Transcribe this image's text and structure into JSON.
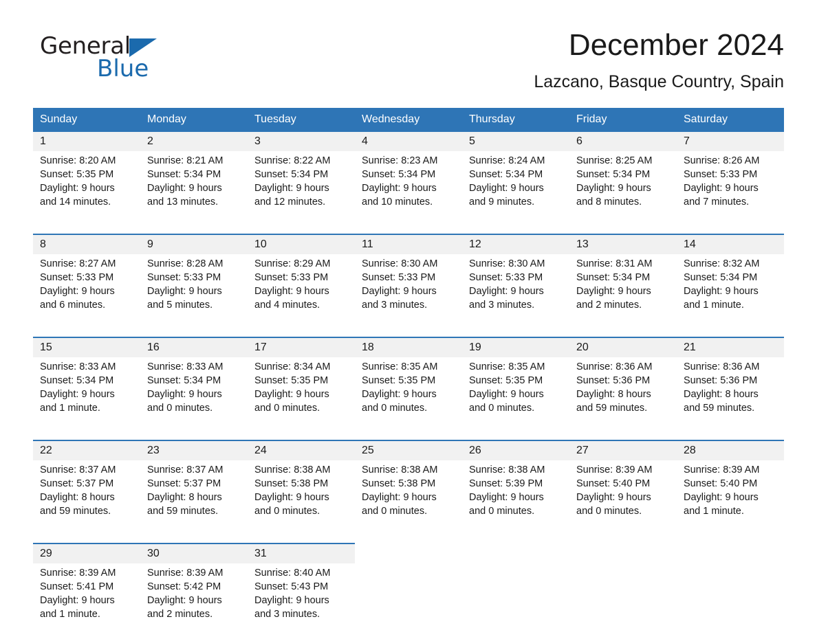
{
  "brand": {
    "name_top": "General",
    "name_bottom": "Blue",
    "accent_color": "#1b6aad"
  },
  "header": {
    "month_title": "December 2024",
    "location": "Lazcano, Basque Country, Spain"
  },
  "theme": {
    "header_blue": "#2e75b6",
    "daynum_band": "#f1f1f1",
    "text": "#1a1a1a"
  },
  "calendar": {
    "weekday_headers": [
      "Sunday",
      "Monday",
      "Tuesday",
      "Wednesday",
      "Thursday",
      "Friday",
      "Saturday"
    ],
    "weeks": [
      [
        {
          "day": "1",
          "sunrise": "Sunrise: 8:20 AM",
          "sunset": "Sunset: 5:35 PM",
          "daylight_line1": "Daylight: 9 hours",
          "daylight_line2": "and 14 minutes."
        },
        {
          "day": "2",
          "sunrise": "Sunrise: 8:21 AM",
          "sunset": "Sunset: 5:34 PM",
          "daylight_line1": "Daylight: 9 hours",
          "daylight_line2": "and 13 minutes."
        },
        {
          "day": "3",
          "sunrise": "Sunrise: 8:22 AM",
          "sunset": "Sunset: 5:34 PM",
          "daylight_line1": "Daylight: 9 hours",
          "daylight_line2": "and 12 minutes."
        },
        {
          "day": "4",
          "sunrise": "Sunrise: 8:23 AM",
          "sunset": "Sunset: 5:34 PM",
          "daylight_line1": "Daylight: 9 hours",
          "daylight_line2": "and 10 minutes."
        },
        {
          "day": "5",
          "sunrise": "Sunrise: 8:24 AM",
          "sunset": "Sunset: 5:34 PM",
          "daylight_line1": "Daylight: 9 hours",
          "daylight_line2": "and 9 minutes."
        },
        {
          "day": "6",
          "sunrise": "Sunrise: 8:25 AM",
          "sunset": "Sunset: 5:34 PM",
          "daylight_line1": "Daylight: 9 hours",
          "daylight_line2": "and 8 minutes."
        },
        {
          "day": "7",
          "sunrise": "Sunrise: 8:26 AM",
          "sunset": "Sunset: 5:33 PM",
          "daylight_line1": "Daylight: 9 hours",
          "daylight_line2": "and 7 minutes."
        }
      ],
      [
        {
          "day": "8",
          "sunrise": "Sunrise: 8:27 AM",
          "sunset": "Sunset: 5:33 PM",
          "daylight_line1": "Daylight: 9 hours",
          "daylight_line2": "and 6 minutes."
        },
        {
          "day": "9",
          "sunrise": "Sunrise: 8:28 AM",
          "sunset": "Sunset: 5:33 PM",
          "daylight_line1": "Daylight: 9 hours",
          "daylight_line2": "and 5 minutes."
        },
        {
          "day": "10",
          "sunrise": "Sunrise: 8:29 AM",
          "sunset": "Sunset: 5:33 PM",
          "daylight_line1": "Daylight: 9 hours",
          "daylight_line2": "and 4 minutes."
        },
        {
          "day": "11",
          "sunrise": "Sunrise: 8:30 AM",
          "sunset": "Sunset: 5:33 PM",
          "daylight_line1": "Daylight: 9 hours",
          "daylight_line2": "and 3 minutes."
        },
        {
          "day": "12",
          "sunrise": "Sunrise: 8:30 AM",
          "sunset": "Sunset: 5:33 PM",
          "daylight_line1": "Daylight: 9 hours",
          "daylight_line2": "and 3 minutes."
        },
        {
          "day": "13",
          "sunrise": "Sunrise: 8:31 AM",
          "sunset": "Sunset: 5:34 PM",
          "daylight_line1": "Daylight: 9 hours",
          "daylight_line2": "and 2 minutes."
        },
        {
          "day": "14",
          "sunrise": "Sunrise: 8:32 AM",
          "sunset": "Sunset: 5:34 PM",
          "daylight_line1": "Daylight: 9 hours",
          "daylight_line2": "and 1 minute."
        }
      ],
      [
        {
          "day": "15",
          "sunrise": "Sunrise: 8:33 AM",
          "sunset": "Sunset: 5:34 PM",
          "daylight_line1": "Daylight: 9 hours",
          "daylight_line2": "and 1 minute."
        },
        {
          "day": "16",
          "sunrise": "Sunrise: 8:33 AM",
          "sunset": "Sunset: 5:34 PM",
          "daylight_line1": "Daylight: 9 hours",
          "daylight_line2": "and 0 minutes."
        },
        {
          "day": "17",
          "sunrise": "Sunrise: 8:34 AM",
          "sunset": "Sunset: 5:35 PM",
          "daylight_line1": "Daylight: 9 hours",
          "daylight_line2": "and 0 minutes."
        },
        {
          "day": "18",
          "sunrise": "Sunrise: 8:35 AM",
          "sunset": "Sunset: 5:35 PM",
          "daylight_line1": "Daylight: 9 hours",
          "daylight_line2": "and 0 minutes."
        },
        {
          "day": "19",
          "sunrise": "Sunrise: 8:35 AM",
          "sunset": "Sunset: 5:35 PM",
          "daylight_line1": "Daylight: 9 hours",
          "daylight_line2": "and 0 minutes."
        },
        {
          "day": "20",
          "sunrise": "Sunrise: 8:36 AM",
          "sunset": "Sunset: 5:36 PM",
          "daylight_line1": "Daylight: 8 hours",
          "daylight_line2": "and 59 minutes."
        },
        {
          "day": "21",
          "sunrise": "Sunrise: 8:36 AM",
          "sunset": "Sunset: 5:36 PM",
          "daylight_line1": "Daylight: 8 hours",
          "daylight_line2": "and 59 minutes."
        }
      ],
      [
        {
          "day": "22",
          "sunrise": "Sunrise: 8:37 AM",
          "sunset": "Sunset: 5:37 PM",
          "daylight_line1": "Daylight: 8 hours",
          "daylight_line2": "and 59 minutes."
        },
        {
          "day": "23",
          "sunrise": "Sunrise: 8:37 AM",
          "sunset": "Sunset: 5:37 PM",
          "daylight_line1": "Daylight: 8 hours",
          "daylight_line2": "and 59 minutes."
        },
        {
          "day": "24",
          "sunrise": "Sunrise: 8:38 AM",
          "sunset": "Sunset: 5:38 PM",
          "daylight_line1": "Daylight: 9 hours",
          "daylight_line2": "and 0 minutes."
        },
        {
          "day": "25",
          "sunrise": "Sunrise: 8:38 AM",
          "sunset": "Sunset: 5:38 PM",
          "daylight_line1": "Daylight: 9 hours",
          "daylight_line2": "and 0 minutes."
        },
        {
          "day": "26",
          "sunrise": "Sunrise: 8:38 AM",
          "sunset": "Sunset: 5:39 PM",
          "daylight_line1": "Daylight: 9 hours",
          "daylight_line2": "and 0 minutes."
        },
        {
          "day": "27",
          "sunrise": "Sunrise: 8:39 AM",
          "sunset": "Sunset: 5:40 PM",
          "daylight_line1": "Daylight: 9 hours",
          "daylight_line2": "and 0 minutes."
        },
        {
          "day": "28",
          "sunrise": "Sunrise: 8:39 AM",
          "sunset": "Sunset: 5:40 PM",
          "daylight_line1": "Daylight: 9 hours",
          "daylight_line2": "and 1 minute."
        }
      ],
      [
        {
          "day": "29",
          "sunrise": "Sunrise: 8:39 AM",
          "sunset": "Sunset: 5:41 PM",
          "daylight_line1": "Daylight: 9 hours",
          "daylight_line2": "and 1 minute."
        },
        {
          "day": "30",
          "sunrise": "Sunrise: 8:39 AM",
          "sunset": "Sunset: 5:42 PM",
          "daylight_line1": "Daylight: 9 hours",
          "daylight_line2": "and 2 minutes."
        },
        {
          "day": "31",
          "sunrise": "Sunrise: 8:40 AM",
          "sunset": "Sunset: 5:43 PM",
          "daylight_line1": "Daylight: 9 hours",
          "daylight_line2": "and 3 minutes."
        },
        {
          "day": "",
          "sunrise": "",
          "sunset": "",
          "daylight_line1": "",
          "daylight_line2": ""
        },
        {
          "day": "",
          "sunrise": "",
          "sunset": "",
          "daylight_line1": "",
          "daylight_line2": ""
        },
        {
          "day": "",
          "sunrise": "",
          "sunset": "",
          "daylight_line1": "",
          "daylight_line2": ""
        },
        {
          "day": "",
          "sunrise": "",
          "sunset": "",
          "daylight_line1": "",
          "daylight_line2": ""
        }
      ]
    ]
  }
}
